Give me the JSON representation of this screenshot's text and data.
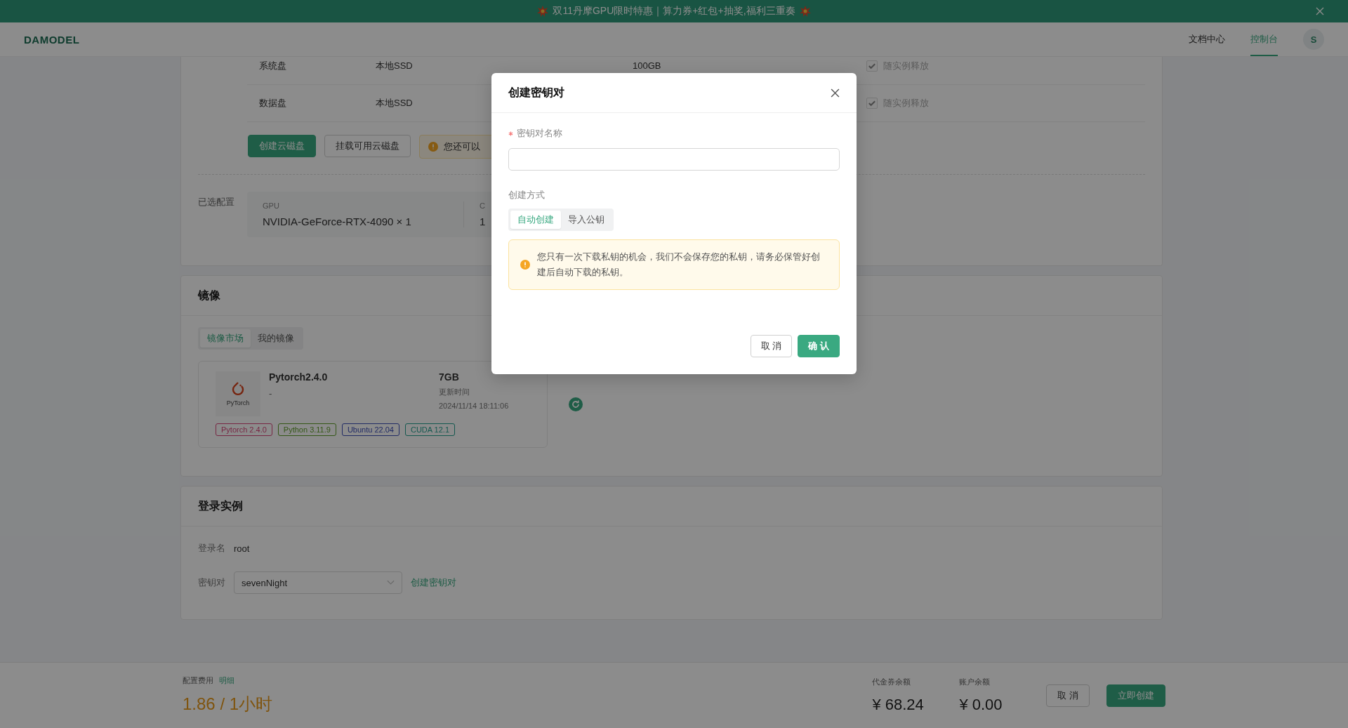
{
  "banner": {
    "text": "双11丹摩GPU限时特惠｜算力券+红包+抽奖,福利三重奏"
  },
  "header": {
    "logo": "DAMODEL",
    "nav": [
      {
        "label": "文档中心",
        "selected": false
      },
      {
        "label": "控制台",
        "selected": true
      }
    ],
    "avatar": "S"
  },
  "disks": {
    "rows": [
      {
        "name": "系统盘",
        "type": "本地SSD",
        "size": "100GB",
        "release_label": "随实例释放",
        "checked": true
      },
      {
        "name": "数据盘",
        "type": "本地SSD",
        "release_label": "随实例释放",
        "checked": true
      }
    ],
    "buttons": [
      {
        "label": "创建云磁盘",
        "kind": "primary"
      },
      {
        "label": "挂载可用云磁盘",
        "kind": "default"
      }
    ],
    "notice": "您还可以"
  },
  "selected_config": {
    "label": "已选配置",
    "columns": [
      {
        "label": "GPU",
        "value": "NVIDIA-GeForce-RTX-4090 × 1"
      },
      {
        "label": "C",
        "value": "1"
      }
    ]
  },
  "image_section": {
    "title": "镜像",
    "tabs": [
      {
        "label": "镜像市场",
        "selected": true
      },
      {
        "label": "我的镜像",
        "selected": false
      }
    ],
    "image": {
      "logo_text": "PyTorch",
      "name": "Pytorch2.4.0",
      "description": "-",
      "size": "7GB",
      "updated_label": "更新时间",
      "updated": "2024/11/14 18:11:06",
      "tags": [
        {
          "label": "Pytorch 2.4.0",
          "color": "#772743"
        },
        {
          "label": "Python 3.11.9",
          "color": "#345717"
        },
        {
          "label": "Ubuntu 22.04",
          "color": "#212b64"
        },
        {
          "label": "CUDA 12.1",
          "color": "#14584f"
        }
      ]
    }
  },
  "login_section": {
    "title": "登录实例",
    "login_name_label": "登录名",
    "login_name": "root",
    "keypair_label": "密钥对",
    "keypair_value": "sevenNight",
    "create_link": "创建密钥对"
  },
  "footer": {
    "cost_label": "配置费用",
    "detail_link": "明细",
    "price": "1.86 / 1小时",
    "voucher_label": "代金券余额",
    "voucher": "¥ 68.24",
    "balance_label": "账户余额",
    "balance": "¥ 0.00",
    "buttons": [
      {
        "label": "取 消",
        "kind": "default"
      },
      {
        "label": "立即创建",
        "kind": "primary"
      }
    ]
  },
  "modal": {
    "title": "创建密钥对",
    "name_field": {
      "label": "密钥对名称",
      "required": true
    },
    "method_label": "创建方式",
    "methods": [
      {
        "label": "自动创建",
        "selected": true
      },
      {
        "label": "导入公钥",
        "selected": false
      }
    ],
    "notice": "您只有一次下载私钥的机会，我们不会保存您的私钥，请务必保管好创建后自动下载的私钥。",
    "buttons": [
      {
        "label": "取 消",
        "kind": "default"
      },
      {
        "label": "确 认",
        "kind": "primary"
      }
    ]
  }
}
